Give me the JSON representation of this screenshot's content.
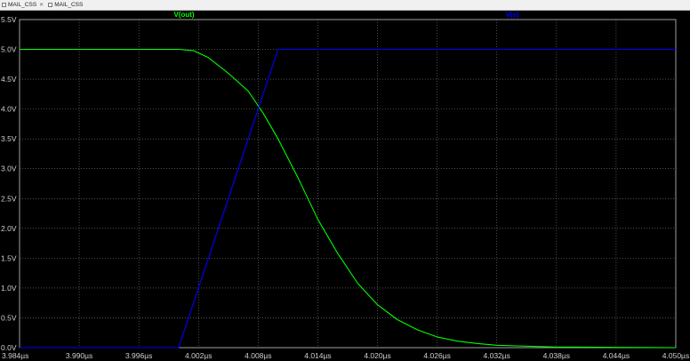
{
  "tabs": [
    {
      "label": "MAIL_CSS"
    },
    {
      "label": "MAIL_CSS"
    }
  ],
  "colors": {
    "background": "#000000",
    "grid": "#808080",
    "tick_text": "#d0d0d0",
    "vout": "#00ff00",
    "vs": "#0000ff"
  },
  "chart_data": {
    "type": "line",
    "xlim": [
      3.984,
      4.05
    ],
    "ylim": [
      0.0,
      5.5
    ],
    "x_unit": "µs",
    "y_unit": "V",
    "grid": true,
    "xticks": [
      3.984,
      3.99,
      3.996,
      4.002,
      4.008,
      4.014,
      4.02,
      4.026,
      4.032,
      4.038,
      4.044,
      4.05
    ],
    "xtick_labels": [
      "3.984µs",
      "3.990µs",
      "3.996µs",
      "4.002µs",
      "4.008µs",
      "4.014µs",
      "4.020µs",
      "4.026µs",
      "4.032µs",
      "4.038µs",
      "4.044µs",
      "4.050µs"
    ],
    "yticks": [
      0.0,
      0.5,
      1.0,
      1.5,
      2.0,
      2.5,
      3.0,
      3.5,
      4.0,
      4.5,
      5.0,
      5.5
    ],
    "ytick_labels": [
      "0.0V",
      "0.5V",
      "1.0V",
      "1.5V",
      "2.0V",
      "2.5V",
      "3.0V",
      "3.5V",
      "4.0V",
      "4.5V",
      "5.0V",
      "5.5V"
    ],
    "series": [
      {
        "name": "V(out)",
        "color": "#00ff00",
        "x": [
          3.984,
          4.0,
          4.0015,
          4.003,
          4.005,
          4.007,
          4.0085,
          4.01,
          4.012,
          4.014,
          4.016,
          4.018,
          4.02,
          4.022,
          4.024,
          4.026,
          4.028,
          4.03,
          4.032,
          4.034,
          4.036,
          4.038,
          4.04,
          4.044,
          4.05
        ],
        "y": [
          5.0,
          5.0,
          4.98,
          4.86,
          4.6,
          4.3,
          3.93,
          3.5,
          2.85,
          2.15,
          1.58,
          1.08,
          0.72,
          0.47,
          0.3,
          0.18,
          0.11,
          0.07,
          0.04,
          0.03,
          0.02,
          0.01,
          0.01,
          0.005,
          0.0
        ]
      },
      {
        "name": "V(s)",
        "color": "#0000ff",
        "x": [
          3.984,
          4.0,
          4.01,
          4.05
        ],
        "y": [
          0.0,
          0.0,
          5.0,
          5.0
        ]
      }
    ]
  }
}
